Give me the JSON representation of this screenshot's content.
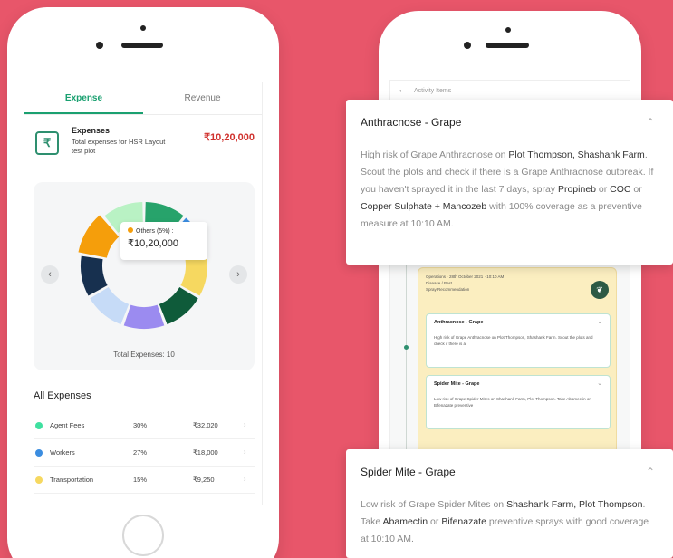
{
  "left_phone": {
    "tabs": [
      {
        "label": "Expense",
        "active": true
      },
      {
        "label": "Revenue",
        "active": false
      }
    ],
    "expenses_header": {
      "title": "Expenses",
      "subtitle": "Total expenses for HSR Layout test plot",
      "amount": "₹10,20,000",
      "amount_color": "#d0312d"
    },
    "chart_data": {
      "type": "pie",
      "segment_colors": [
        "#27a36b",
        "#3b8de0",
        "#f6d860",
        "#0f5b3a",
        "#9b8bf0",
        "#c6dbf7",
        "#17304f",
        "#f59e0b",
        "#b9f2c4"
      ],
      "tooltip": {
        "label": "Others (5%) :",
        "value": "₹10,20,000"
      },
      "total_label": "Total Expenses: 10"
    },
    "nav": {
      "prev_icon": "chevron-left-icon",
      "next_icon": "chevron-right-icon"
    },
    "all_expenses_title": "All Expenses",
    "expense_rows": [
      {
        "name": "Agent Fees",
        "percent": "30%",
        "amount": "₹32,020",
        "color": "#3fe0a0"
      },
      {
        "name": "Workers",
        "percent": "27%",
        "amount": "₹18,000",
        "color": "#3b8de0"
      },
      {
        "name": "Transportation",
        "percent": "15%",
        "amount": "₹9,250",
        "color": "#f6d860"
      }
    ]
  },
  "right_phone": {
    "header_title": "Activity Items",
    "yellow_card": {
      "meta": [
        "Operations · 28th October 2021 · 10:10 AM",
        "Disease / Pest",
        "Spray Recommendation"
      ],
      "mini_cards": [
        {
          "title": "Anthracnose - Grape",
          "body": "High risk of Grape Anthracnose on Plot Thompson, Shashank Farm. Scout the plots and check if there is a"
        },
        {
          "title": "Spider Mite - Grape",
          "body": "Low risk of Grape Spider Mites on Shashank Farm, Plot Thompson. Take Abamectin or Bifenazate preventive"
        }
      ]
    }
  },
  "popups": [
    {
      "title": "Anthracnose - Grape",
      "body": [
        {
          "text": "High risk of Grape Anthracnose on ",
          "em": false
        },
        {
          "text": "Plot Thompson, Shashank Farm",
          "em": true
        },
        {
          "text": ". Scout the plots and check if there is a Grape Anthracnose outbreak. If you haven't sprayed it in the last 7 days, spray ",
          "em": false
        },
        {
          "text": "Propineb",
          "em": true
        },
        {
          "text": " or ",
          "em": false
        },
        {
          "text": "COC",
          "em": true
        },
        {
          "text": " or ",
          "em": false
        },
        {
          "text": "Copper Sulphate + Mancozeb",
          "em": true
        },
        {
          "text": " with 100% coverage as a preventive measure at 10:10 AM.",
          "em": false
        }
      ]
    },
    {
      "title": "Spider Mite - Grape",
      "body": [
        {
          "text": "Low risk of Grape Spider Mites on ",
          "em": false
        },
        {
          "text": "Shashank Farm, Plot Thompson",
          "em": true
        },
        {
          "text": ". Take ",
          "em": false
        },
        {
          "text": "Abamectin",
          "em": true
        },
        {
          "text": " or ",
          "em": false
        },
        {
          "text": "Bifenazate",
          "em": true
        },
        {
          "text": " preventive sprays with good coverage at 10:10 AM.",
          "em": false
        }
      ]
    }
  ],
  "colors": {
    "background": "#e8566a",
    "accent": "#1aa070"
  }
}
